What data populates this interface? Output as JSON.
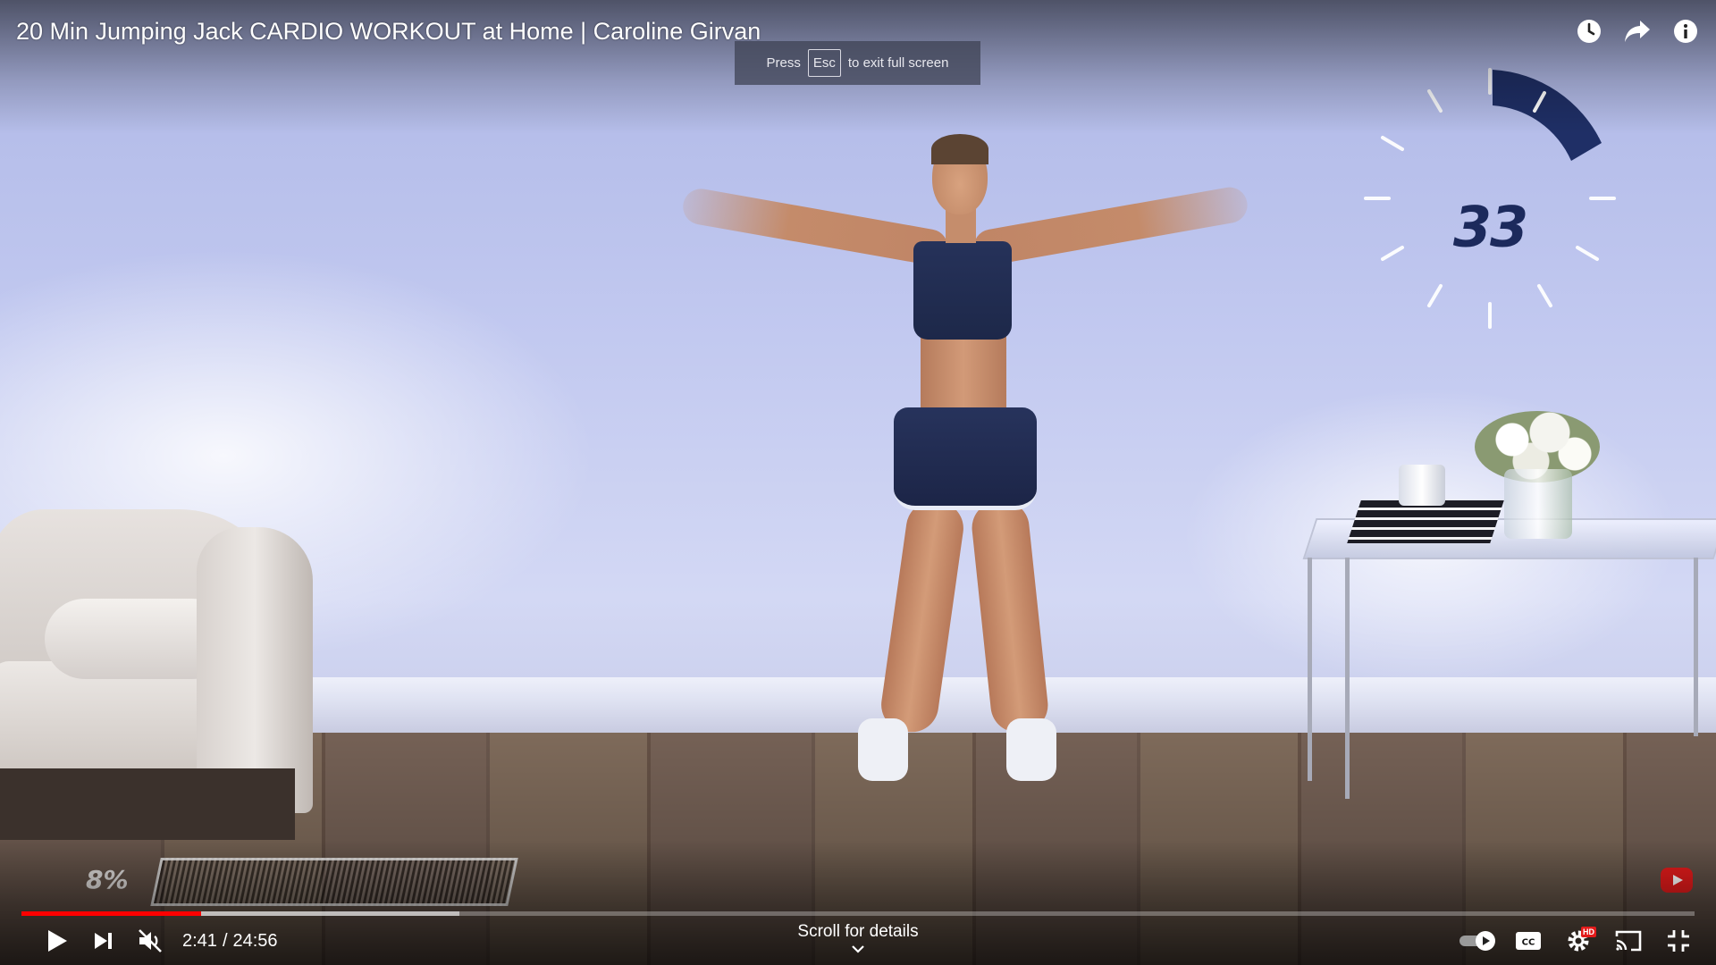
{
  "player": {
    "title": "20 Min Jumping Jack CARDIO WORKOUT at Home | Caroline Girvan",
    "fullscreen_toast": {
      "before": "Press",
      "key": "Esc",
      "after": "to exit full screen"
    },
    "top_icons": [
      "watch-later-icon",
      "share-icon",
      "info-icon"
    ],
    "current_time": "2:41",
    "separator": "/",
    "duration": "24:56",
    "played_fraction": 0.1075,
    "buffered_fraction": 0.262,
    "scroll_hint": "Scroll for details",
    "settings_badge": "HD",
    "controls_left": [
      "play-icon",
      "next-icon",
      "muted-volume-icon"
    ],
    "controls_right": [
      "autoplay-toggle",
      "captions-icon",
      "settings-icon",
      "cast-icon",
      "exit-fullscreen-icon"
    ],
    "accent_color": "#ff0000"
  },
  "video_overlay": {
    "timer_value": "33",
    "timer_color": "#1c2a5c",
    "progress_percent_label": "8%"
  }
}
